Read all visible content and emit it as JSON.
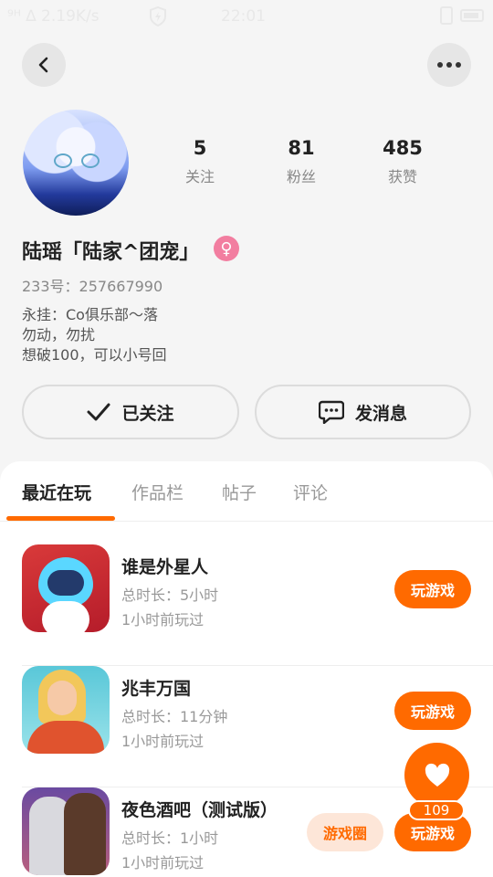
{
  "status_bar": {
    "signal": "⁹ᴴ ∆ 2.19K/s",
    "time": "22:01"
  },
  "profile": {
    "stats": [
      {
        "value": "5",
        "label": "关注"
      },
      {
        "value": "81",
        "label": "粉丝"
      },
      {
        "value": "485",
        "label": "获赞"
      }
    ],
    "username": "陆瑶「陆家^团宠」",
    "gender_symbol": "♀",
    "uid": "233号：257667990",
    "bio": "永挂：Co俱乐部～落\n勿动，勿扰\n想破100，可以小号回"
  },
  "actions": {
    "follow_label": "已关注",
    "message_label": "发消息"
  },
  "tabs": [
    {
      "label": "最近在玩"
    },
    {
      "label": "作品栏"
    },
    {
      "label": "帖子"
    },
    {
      "label": "评论"
    }
  ],
  "games": [
    {
      "title": "谁是外星人",
      "duration": "总时长：5小时",
      "last_played": "1小时前玩过",
      "play_label": "玩游戏",
      "icon": "alien-game-icon"
    },
    {
      "title": "兆丰万国",
      "duration": "总时长：11分钟",
      "last_played": "1小时前玩过",
      "play_label": "玩游戏",
      "icon": "noodle-game-icon"
    },
    {
      "title": "夜色酒吧（测试版）",
      "duration": "总时长：1小时",
      "last_played": "1小时前玩过",
      "play_label": "玩游戏",
      "circle_label": "游戏圈",
      "icon": "bar-game-icon"
    }
  ],
  "like_fab": {
    "count": "109",
    "color": "#ff6a00"
  },
  "colors": {
    "accent": "#ff6a00",
    "background": "#f5f5f5",
    "gender_badge": "#f27ea0"
  }
}
